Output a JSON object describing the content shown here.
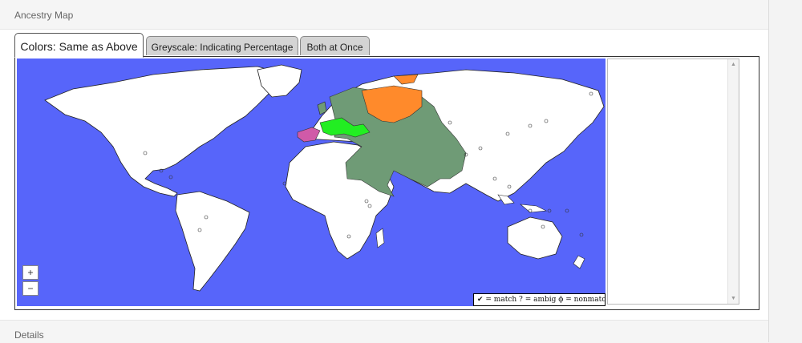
{
  "panel": {
    "title": "Ancestry Map"
  },
  "tabs": [
    {
      "label": "Colors: Same as Above",
      "active": true
    },
    {
      "label": "Greyscale: Indicating Percentage",
      "active": false
    },
    {
      "label": "Both at Once",
      "active": false
    }
  ],
  "map": {
    "zoom_in": "+",
    "zoom_out": "−",
    "legend": "✔ = match   ? = ambig   ϕ = nonmatch",
    "colors": {
      "ocean": "#5765fa",
      "land": "#ffffff",
      "green_region": "#6f9b76",
      "orange_region": "#ff8a2b",
      "bright_green_region": "#22ee22",
      "pink_region": "#d05aa8"
    }
  },
  "sidebar": {
    "icons": [
      "scroll-up-icon",
      "scroll-down-icon"
    ]
  },
  "details": {
    "title": "Details"
  }
}
